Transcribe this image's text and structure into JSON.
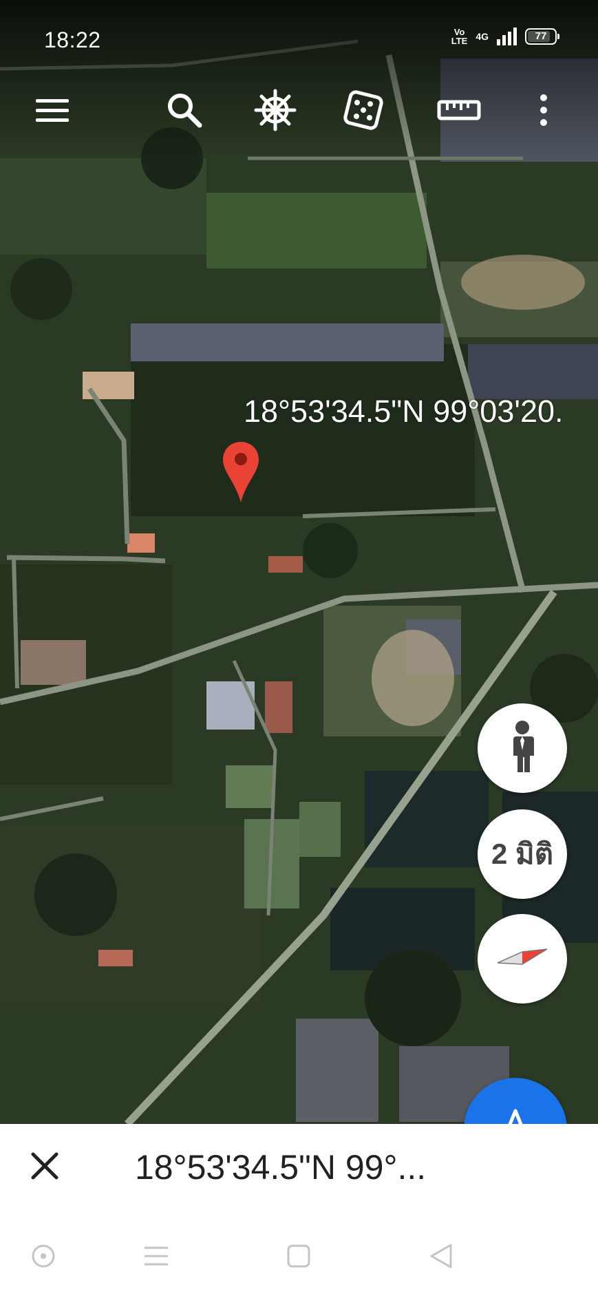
{
  "status_bar": {
    "time": "18:22",
    "volte_line1": "Vo",
    "volte_line2": "LTE",
    "network": "4G",
    "battery": "77"
  },
  "toolbar": {
    "icons": [
      "menu-icon",
      "search-icon",
      "ship-wheel-icon",
      "dice-icon",
      "ruler-icon",
      "more-vert-icon"
    ]
  },
  "map": {
    "type": "satellite",
    "coordinate_label": "18°53'34.5\"N 99°03'20."
  },
  "controls": {
    "view_2d_label": "2 มิติ",
    "icons": [
      "person-icon",
      "compass-icon",
      "navigation-icon"
    ],
    "accent": "#1a73e8",
    "pin_color": "#ea4335"
  },
  "bottom_sheet": {
    "title": "18°53'34.5\"N 99°..."
  },
  "system_nav": {
    "icons": [
      "recent-circle-icon",
      "menu-lines-icon",
      "home-square-icon",
      "back-triangle-icon"
    ]
  }
}
